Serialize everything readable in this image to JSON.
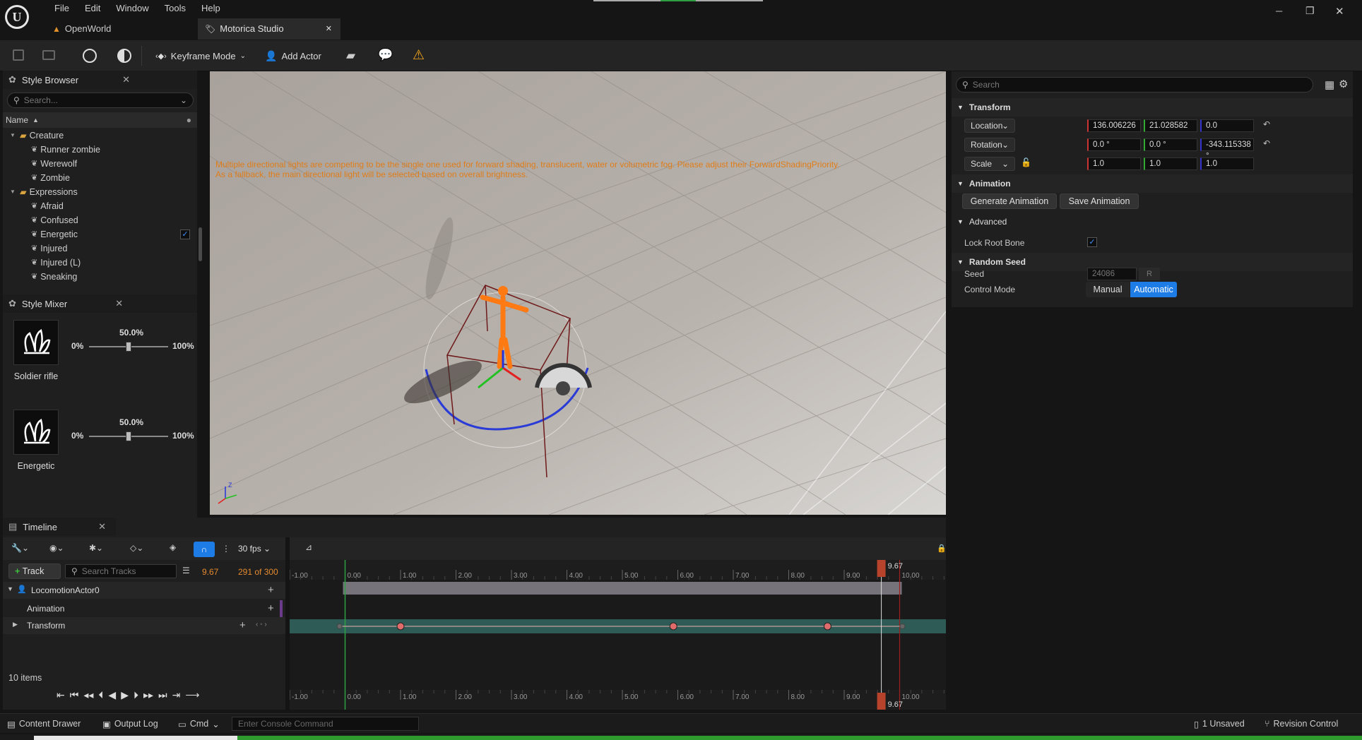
{
  "menu": [
    "File",
    "Edit",
    "Window",
    "Tools",
    "Help"
  ],
  "doc_tabs": {
    "inactive": "OpenWorld",
    "active": "Motorica Studio"
  },
  "window_controls": {
    "min": "─",
    "max": "❐",
    "close": "✕"
  },
  "toolbar": {
    "mode": "Keyframe Mode",
    "add_actor": "Add Actor"
  },
  "style_browser": {
    "title": "Style Browser",
    "search_placeholder": "Search...",
    "column_name": "Name",
    "tree": [
      {
        "label": "Creature",
        "type": "folder",
        "indent": 0
      },
      {
        "label": "Runner zombie",
        "type": "item",
        "indent": 1
      },
      {
        "label": "Werewolf",
        "type": "item",
        "indent": 1
      },
      {
        "label": "Zombie",
        "type": "item",
        "indent": 1
      },
      {
        "label": "Expressions",
        "type": "folder",
        "indent": 0
      },
      {
        "label": "Afraid",
        "type": "item",
        "indent": 1
      },
      {
        "label": "Confused",
        "type": "item",
        "indent": 1
      },
      {
        "label": "Energetic",
        "type": "item",
        "indent": 1,
        "checked": true
      },
      {
        "label": "Injured",
        "type": "item",
        "indent": 1
      },
      {
        "label": "Injured (L)",
        "type": "item",
        "indent": 1
      },
      {
        "label": "Sneaking",
        "type": "item",
        "indent": 1
      }
    ]
  },
  "style_mixer": {
    "title": "Style Mixer",
    "rows": [
      {
        "name": "Soldier rifle",
        "value": "50.0%",
        "fraction": 0.5,
        "min": "0%",
        "max": "100%"
      },
      {
        "name": "Energetic",
        "value": "50.0%",
        "fraction": 0.5,
        "min": "0%",
        "max": "100%"
      }
    ]
  },
  "viewport": {
    "warning": "Multiple directional lights are competing to be the single one used for forward shading, translucent, water or volumetric fog. Please adjust their ForwardShadingPriority.",
    "warning2": "As a fallback, the main directional light will be selected based on overall brightness."
  },
  "details": {
    "search_placeholder": "Search",
    "transform_header": "Transform",
    "location": {
      "label": "Location",
      "x": "136.006226",
      "y": "21.028582",
      "z": "0.0"
    },
    "rotation": {
      "label": "Rotation",
      "x": "0.0 °",
      "y": "0.0 °",
      "z": "-343.115338 °"
    },
    "scale": {
      "label": "Scale",
      "x": "1.0",
      "y": "1.0",
      "z": "1.0"
    },
    "animation_header": "Animation",
    "generate_btn": "Generate Animation",
    "save_btn": "Save Animation",
    "advanced_header": "Advanced",
    "lock_root_bone": "Lock Root Bone",
    "random_seed_header": "Random Seed",
    "seed_label": "Seed",
    "seed_value": "24086",
    "seed_btn": "R",
    "control_mode_label": "Control Mode",
    "manual": "Manual",
    "automatic": "Automatic"
  },
  "timeline": {
    "title": "Timeline",
    "fps": "30 fps",
    "track_btn": "Track",
    "search_placeholder": "Search Tracks",
    "current_time": "9.67",
    "frame_info": "291 of 300",
    "playhead_label": "9.67",
    "tracks": [
      {
        "label": "LocomotionActor0"
      },
      {
        "label": "Animation"
      },
      {
        "label": "Transform"
      }
    ],
    "items_count": "10 items",
    "ruler": [
      "-1.00",
      "0.00",
      "1.00",
      "2.00",
      "3.00",
      "4.00",
      "5.00",
      "6.00",
      "7.00",
      "8.00",
      "9.00",
      "10.00"
    ],
    "keyframes": [
      1.0,
      5.92,
      8.7
    ],
    "playhead": 9.67
  },
  "statusbar": {
    "content_drawer": "Content Drawer",
    "output_log": "Output Log",
    "cmd": "Cmd",
    "console_placeholder": "Enter Console Command",
    "unsaved": "1 Unsaved",
    "revision": "Revision Control"
  }
}
